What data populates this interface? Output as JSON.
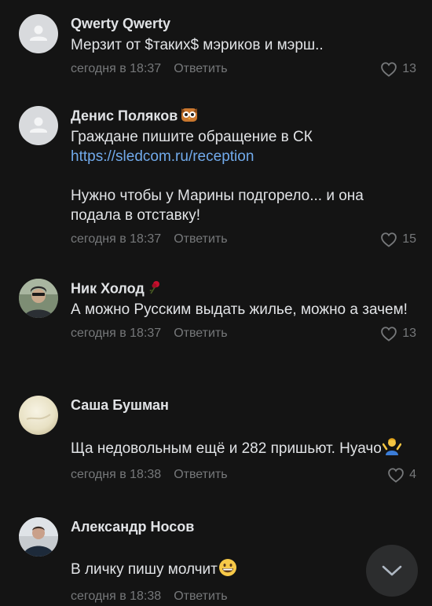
{
  "comments": [
    {
      "author": "Qwerty Qwerty",
      "text": "Мерзит от $таких$ мэриков и мэрш..",
      "time": "сегодня в 18:37",
      "reply_label": "Ответить",
      "likes": "13"
    },
    {
      "author": "Денис Поляков",
      "author_emoji": "owl-face",
      "text": "Граждане пишите обращение в СК",
      "link": "https://sledcom.ru/reception",
      "text2": "Нужно чтобы у Марины подгорело... и она подала в отставку!",
      "time": "сегодня в 18:37",
      "reply_label": "Ответить",
      "likes": "15"
    },
    {
      "author": "Ник Холод",
      "author_emoji": "rose",
      "text": "А можно Русским выдать жилье, можно а зачем!",
      "time": "сегодня в 18:37",
      "reply_label": "Ответить",
      "likes": "13"
    },
    {
      "author": "Саша Бушман",
      "text": "Ща недовольным ещё и 282 пришьют. Нуачо",
      "text_emoji": "person-shrugging",
      "time": "сегодня в 18:38",
      "reply_label": "Ответить",
      "likes": "4"
    },
    {
      "author": "Александр Носов",
      "text": "В личку пишу молчит",
      "text_emoji": "grinning-face",
      "time": "сегодня в 18:38",
      "reply_label": "Ответить"
    }
  ],
  "icons": {
    "like": "heart-outline-icon",
    "scroll": "chevron-down-icon"
  },
  "colors": {
    "background": "#141414",
    "text": "#e1e3e6",
    "secondary": "#76787a",
    "link": "#71aaeb"
  }
}
